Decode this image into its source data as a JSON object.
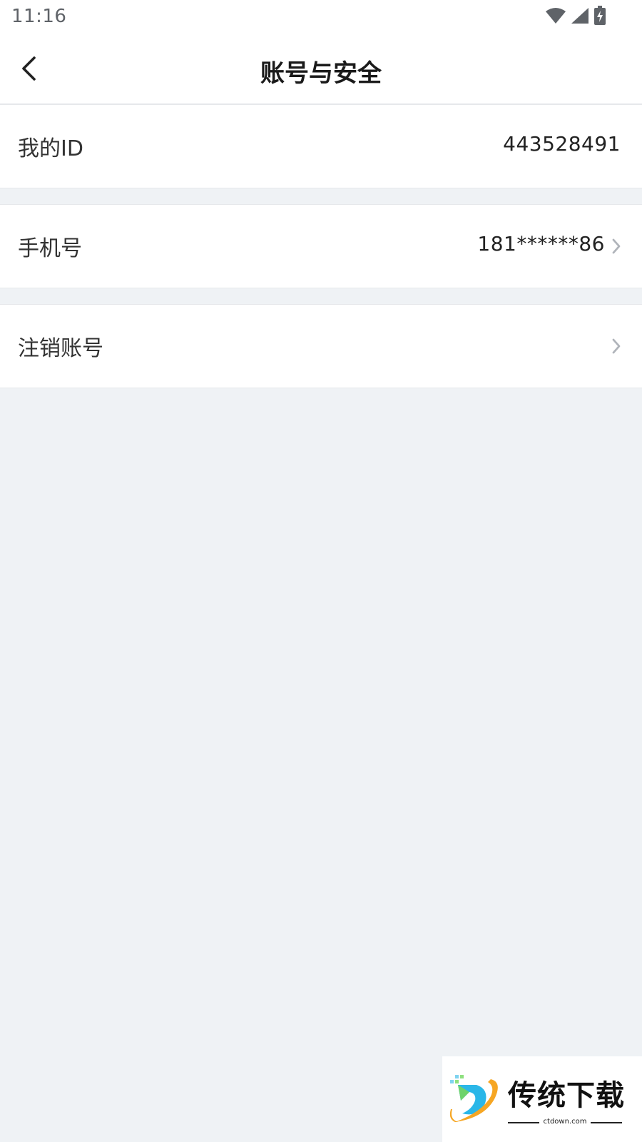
{
  "status_bar": {
    "time": "11:16",
    "icons": [
      "wifi-icon",
      "cell-signal-icon",
      "battery-charging-icon"
    ]
  },
  "nav": {
    "title": "账号与安全",
    "back_icon": "chevron-left-icon"
  },
  "rows": [
    {
      "label": "我的ID",
      "value": "443528491",
      "chevron": false
    },
    {
      "label": "手机号",
      "value": "181******86",
      "chevron": true
    },
    {
      "label": "注销账号",
      "value": "",
      "chevron": true
    }
  ],
  "watermark": {
    "text": "传统下载",
    "domain": "ctdown.com"
  },
  "colors": {
    "background": "#eff2f5",
    "surface": "#ffffff",
    "divider": "#e6e8eb",
    "text_primary": "#333333",
    "chevron": "#b0b4ba"
  }
}
